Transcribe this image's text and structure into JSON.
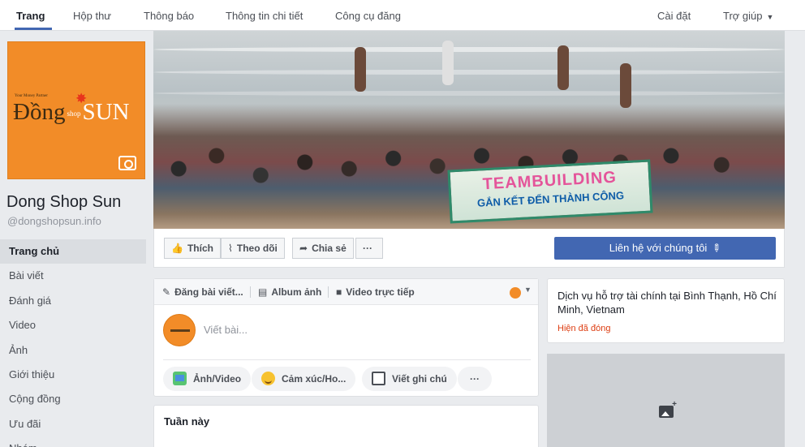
{
  "top_nav": {
    "tabs": [
      "Trang",
      "Hộp thư",
      "Thông báo",
      "Thông tin chi tiết",
      "Công cụ đăng"
    ],
    "settings": "Cài đặt",
    "help": "Trợ giúp"
  },
  "profile": {
    "logo_tagline": "Your Money Partner",
    "logo_word_1": "Đồng",
    "logo_word_2": "shop",
    "logo_word_3": "SUN",
    "name": "Dong Shop Sun",
    "handle": "@dongshopsun.info"
  },
  "left_nav": [
    "Trang chủ",
    "Bài viết",
    "Đánh giá",
    "Video",
    "Ảnh",
    "Giới thiệu",
    "Cộng đồng",
    "Ưu đãi",
    "Nhóm"
  ],
  "cover": {
    "banner_top": "TEAMBUILDING",
    "banner_bottom": "GẮN KẾT ĐẾN THÀNH CÔNG"
  },
  "action_bar": {
    "like": "Thích",
    "follow": "Theo dõi",
    "share": "Chia sẻ",
    "more": "···",
    "cta": "Liên hệ với chúng tôi"
  },
  "composer": {
    "tab_post": "Đăng bài viết...",
    "tab_album": "Album ảnh",
    "tab_live": "Video trực tiếp",
    "placeholder": "Viết bài...",
    "chip_photo": "Ảnh/Video",
    "chip_feeling": "Cảm xúc/Ho...",
    "chip_note": "Viết ghi chú",
    "chip_more": "···"
  },
  "week": {
    "title": "Tuần này"
  },
  "about": {
    "text": "Dịch vụ hỗ trợ tài chính tại Bình Thạnh, Hồ Chí Minh, Vietnam",
    "status": "Hiện đã đóng"
  },
  "colors": {
    "brand_blue": "#4267b2",
    "logo_orange": "#f28c28",
    "closed_red": "#dd3c10"
  }
}
